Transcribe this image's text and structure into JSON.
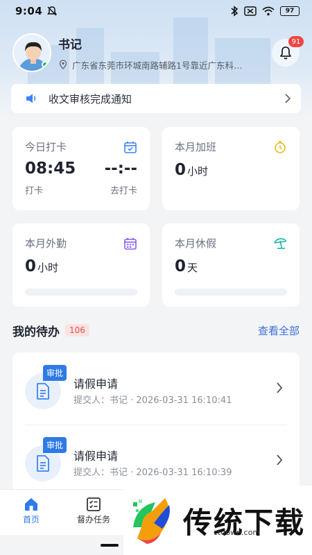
{
  "status_bar": {
    "time": "9:04",
    "battery": "97"
  },
  "header": {
    "user_name": "书记",
    "location": "广东省东莞市环城南路辅路1号靠近广东科…",
    "notification_count": "91"
  },
  "notice": {
    "text": "收文审核完成通知"
  },
  "stats": {
    "checkin": {
      "title": "今日打卡",
      "check_time": "08:45",
      "check_label": "打卡",
      "pending_time": "--:--",
      "pending_label": "去打卡"
    },
    "overtime": {
      "title": "本月加班",
      "value": "0",
      "unit": "小时"
    },
    "field": {
      "title": "本月外勤",
      "value": "0",
      "unit": "小时",
      "progress": 0
    },
    "leave": {
      "title": "本月休假",
      "value": "0",
      "unit": "天",
      "progress": 0
    }
  },
  "todo": {
    "section_title": "我的待办",
    "count": "106",
    "view_all": "查看全部",
    "items": [
      {
        "tag": "审批",
        "name": "请假申请",
        "meta": "提交人：书记 · 2026-03-31 16:10:41"
      },
      {
        "tag": "审批",
        "name": "请假申请",
        "meta": "提交人：书记 · 2026-03-31 16:10:39"
      }
    ]
  },
  "tabbar": {
    "tabs": [
      {
        "label": "首页",
        "active": true
      },
      {
        "label": "督办任务",
        "active": false
      }
    ]
  },
  "watermark": {
    "text": "传统下载",
    "url": "ctdown.com"
  },
  "colors": {
    "accent": "#2f7ae5",
    "badge": "#ef4444",
    "online": "#22c55e"
  }
}
